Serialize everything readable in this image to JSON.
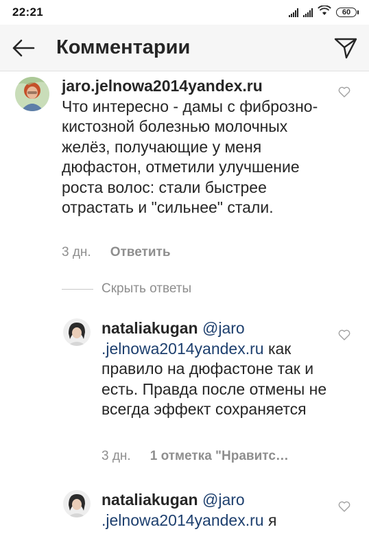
{
  "status_bar": {
    "time": "22:21",
    "battery": "60",
    "icons": [
      "signal-icon",
      "signal-icon",
      "wifi-icon",
      "battery-icon"
    ]
  },
  "header": {
    "title": "Комментарии",
    "back_icon": "arrow-left-icon",
    "send_icon": "paper-plane-icon"
  },
  "comments": [
    {
      "username": "jaro.jelnowa2014yandex.ru",
      "text": "Что интересно - дамы с фиброзно-кистозной болезнью молочных желёз, получающие у меня дюфастон, отметили улучшение роста волос: стали быстрее отрастать и \"сильнее\" стали.",
      "time": "3 дн.",
      "action": "Ответить"
    }
  ],
  "hide_replies": "Скрыть ответы",
  "replies": [
    {
      "username": "nataliakugan",
      "mention_part1": "@jaro",
      "mention_part2": ".jelnowa2014yandex.ru",
      "text_line1_rest": " как",
      "text": "правило на дюфастоне так и есть. Правда после отмены не всегда эффект сохраняется",
      "time": "3 дн.",
      "likes": "1 отметка \"Нравитс…"
    },
    {
      "username": "nataliakugan",
      "mention_part1": "@jaro",
      "mention_part2": ".jelnowa2014yandex.ru",
      "text_line1_rest": " я"
    }
  ],
  "colors": {
    "mention": "#1d3f6e",
    "muted": "#8e8e8e",
    "text": "#262626"
  }
}
